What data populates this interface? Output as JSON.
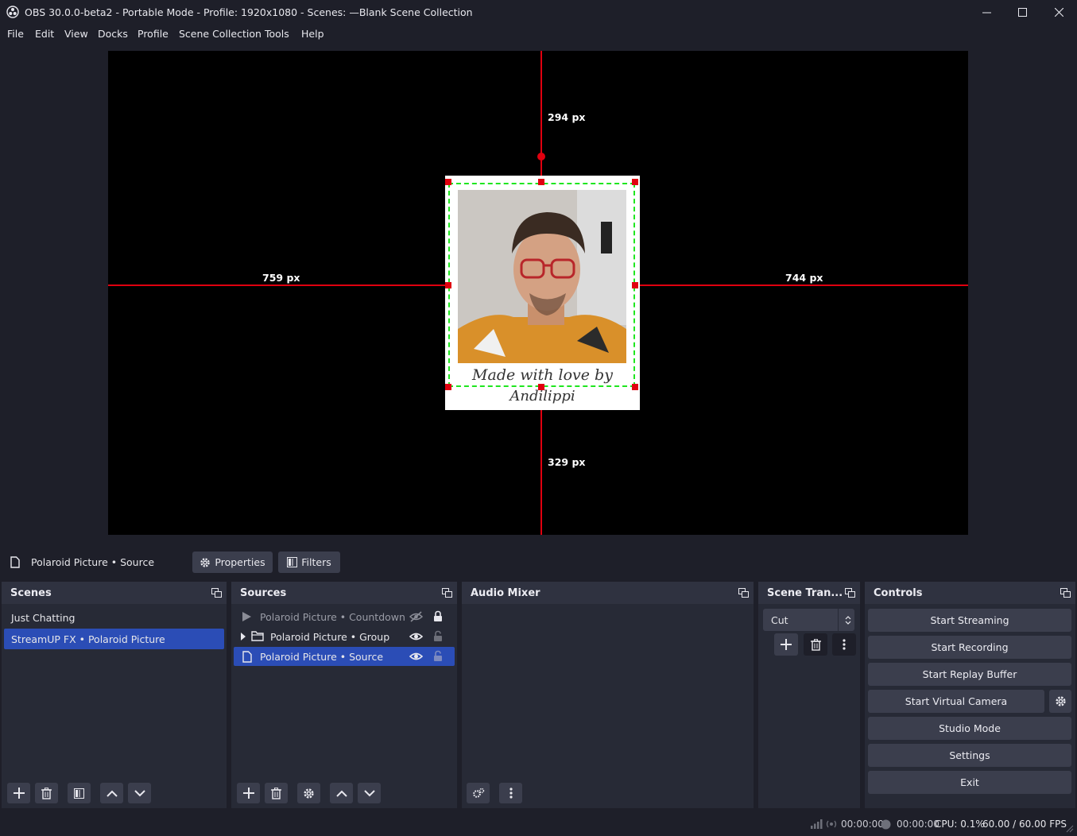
{
  "window": {
    "title": "OBS 30.0.0-beta2 - Portable Mode - Profile: 1920x1080 - Scenes: —Blank Scene Collection"
  },
  "menu": [
    "File",
    "Edit",
    "View",
    "Docks",
    "Profile",
    "Scene Collection",
    "Tools",
    "Help"
  ],
  "preview": {
    "dim_top": "294 px",
    "dim_left": "759 px",
    "dim_right": "744 px",
    "dim_bottom": "329 px",
    "polaroid_caption_line1": "Made with love by",
    "polaroid_caption_line2": "Andilippi"
  },
  "source_toolbar": {
    "selected_source": "Polaroid Picture • Source",
    "properties_label": "Properties",
    "filters_label": "Filters"
  },
  "scenes": {
    "title": "Scenes",
    "items": [
      "Just Chatting",
      "StreamUP FX • Polaroid Picture"
    ],
    "selected_index": 1
  },
  "sources": {
    "title": "Sources",
    "items": [
      {
        "label": "Polaroid Picture • Countdown",
        "type": "media",
        "visible": false,
        "locked": true
      },
      {
        "label": "Polaroid Picture • Group",
        "type": "group",
        "visible": true,
        "locked": false
      },
      {
        "label": "Polaroid Picture • Source",
        "type": "source",
        "visible": true,
        "locked": false
      }
    ],
    "selected_index": 2
  },
  "audio_mixer": {
    "title": "Audio Mixer"
  },
  "transitions": {
    "title": "Scene Tran...",
    "selected": "Cut"
  },
  "controls": {
    "title": "Controls",
    "buttons": [
      "Start Streaming",
      "Start Recording",
      "Start Replay Buffer",
      "Start Virtual Camera",
      "Studio Mode",
      "Settings",
      "Exit"
    ]
  },
  "status": {
    "stream_time": "00:00:00",
    "record_time": "00:00:00",
    "cpu": "CPU: 0.1%",
    "fps": "60.00 / 60.00 FPS"
  },
  "colors": {
    "accent": "#2b4db6",
    "guide_red": "#e0000f",
    "selection_green": "#1fe61f",
    "dock_bg": "#272a36",
    "window_bg": "#1e1f29"
  }
}
